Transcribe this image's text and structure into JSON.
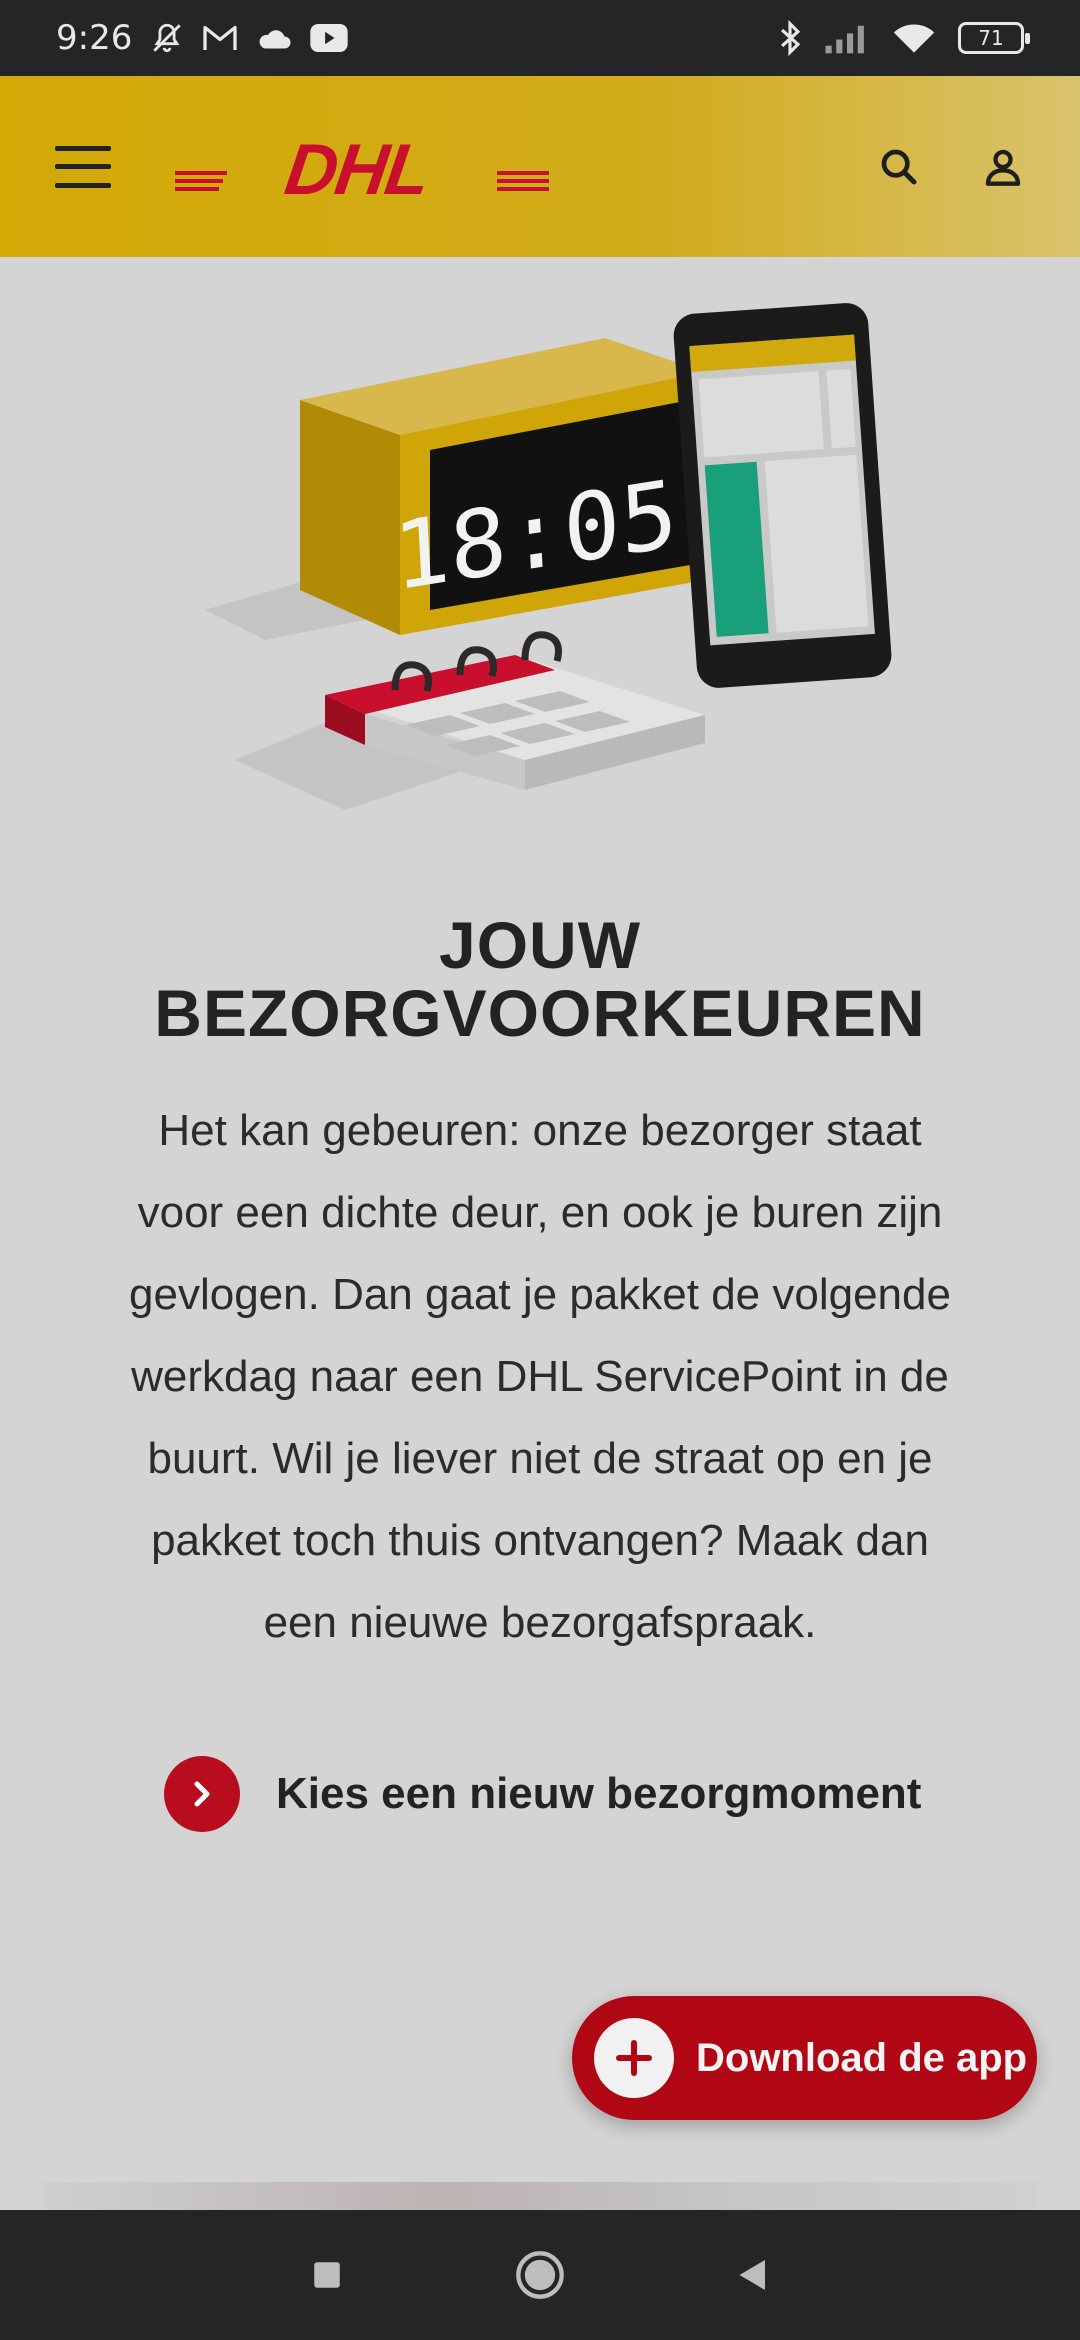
{
  "status_bar": {
    "time": "9:26",
    "battery_level": "71",
    "icons_left": [
      "mute-bell-icon",
      "gmail-icon",
      "cloud-icon",
      "youtube-icon"
    ],
    "icons_right": [
      "bluetooth-icon",
      "signal-icon",
      "wifi-icon",
      "battery-icon"
    ]
  },
  "header": {
    "logo_text": "DHL",
    "menu_icon": "hamburger-menu-icon",
    "search_icon": "search-icon",
    "account_icon": "user-icon",
    "brand_yellow": "#d3a906",
    "brand_red": "#b80d1e"
  },
  "illustration": {
    "clock_time": "18:05"
  },
  "content": {
    "title_line1": "JOUW",
    "title_line2": "BEZORGVOORKEUREN",
    "body_lines": [
      "Het kan gebeuren: onze bezorger staat",
      "voor een dichte deur, en ook je buren zijn",
      "gevlogen. Dan gaat je pakket de volgende",
      "werkdag naar een DHL ServicePoint in de",
      "buurt. Wil je liever niet de straat op en je",
      "pakket toch thuis ontvangen? Maak dan",
      "een nieuwe bezorgafspraak."
    ],
    "cta_label": "Kies een nieuw bezorgmoment"
  },
  "download_button": {
    "label": "Download de app"
  },
  "nav_bar": {
    "buttons": [
      "recents-square-icon",
      "home-circle-icon",
      "back-triangle-icon"
    ]
  }
}
